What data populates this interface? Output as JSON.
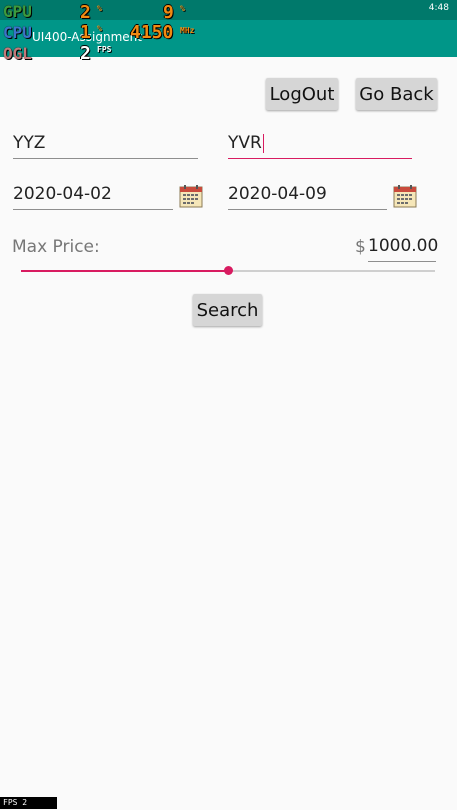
{
  "status_bar": {
    "time": "4:48"
  },
  "app_bar": {
    "title": "UI400-Assignment"
  },
  "overlay": {
    "gpu_label": "GPU",
    "gpu_value": "2",
    "gpu_unit": "%",
    "gpu2_value": "9",
    "gpu2_unit": "%",
    "cpu_label": "CPU",
    "cpu_value": "1",
    "cpu_unit": "%",
    "freq_value": "4150",
    "freq_unit": "MHz",
    "ogl_label": "OGL",
    "fps_value": "2",
    "fps_unit": "FPS",
    "bottom_fps": "FPS    2"
  },
  "buttons": {
    "logout": "LogOut",
    "go_back": "Go Back",
    "search": "Search"
  },
  "form": {
    "origin": "YYZ",
    "destination": "YVR",
    "depart_date": "2020-04-02",
    "return_date": "2020-04-09",
    "max_price_label": "Max Price:",
    "currency_symbol": "$",
    "max_price_value": "1000.00",
    "slider_fraction": 0.5
  },
  "colors": {
    "accent": "#d81b60",
    "primary": "#009688",
    "primary_dark": "#00796b"
  },
  "icons": {
    "calendar": "calendar-icon"
  }
}
